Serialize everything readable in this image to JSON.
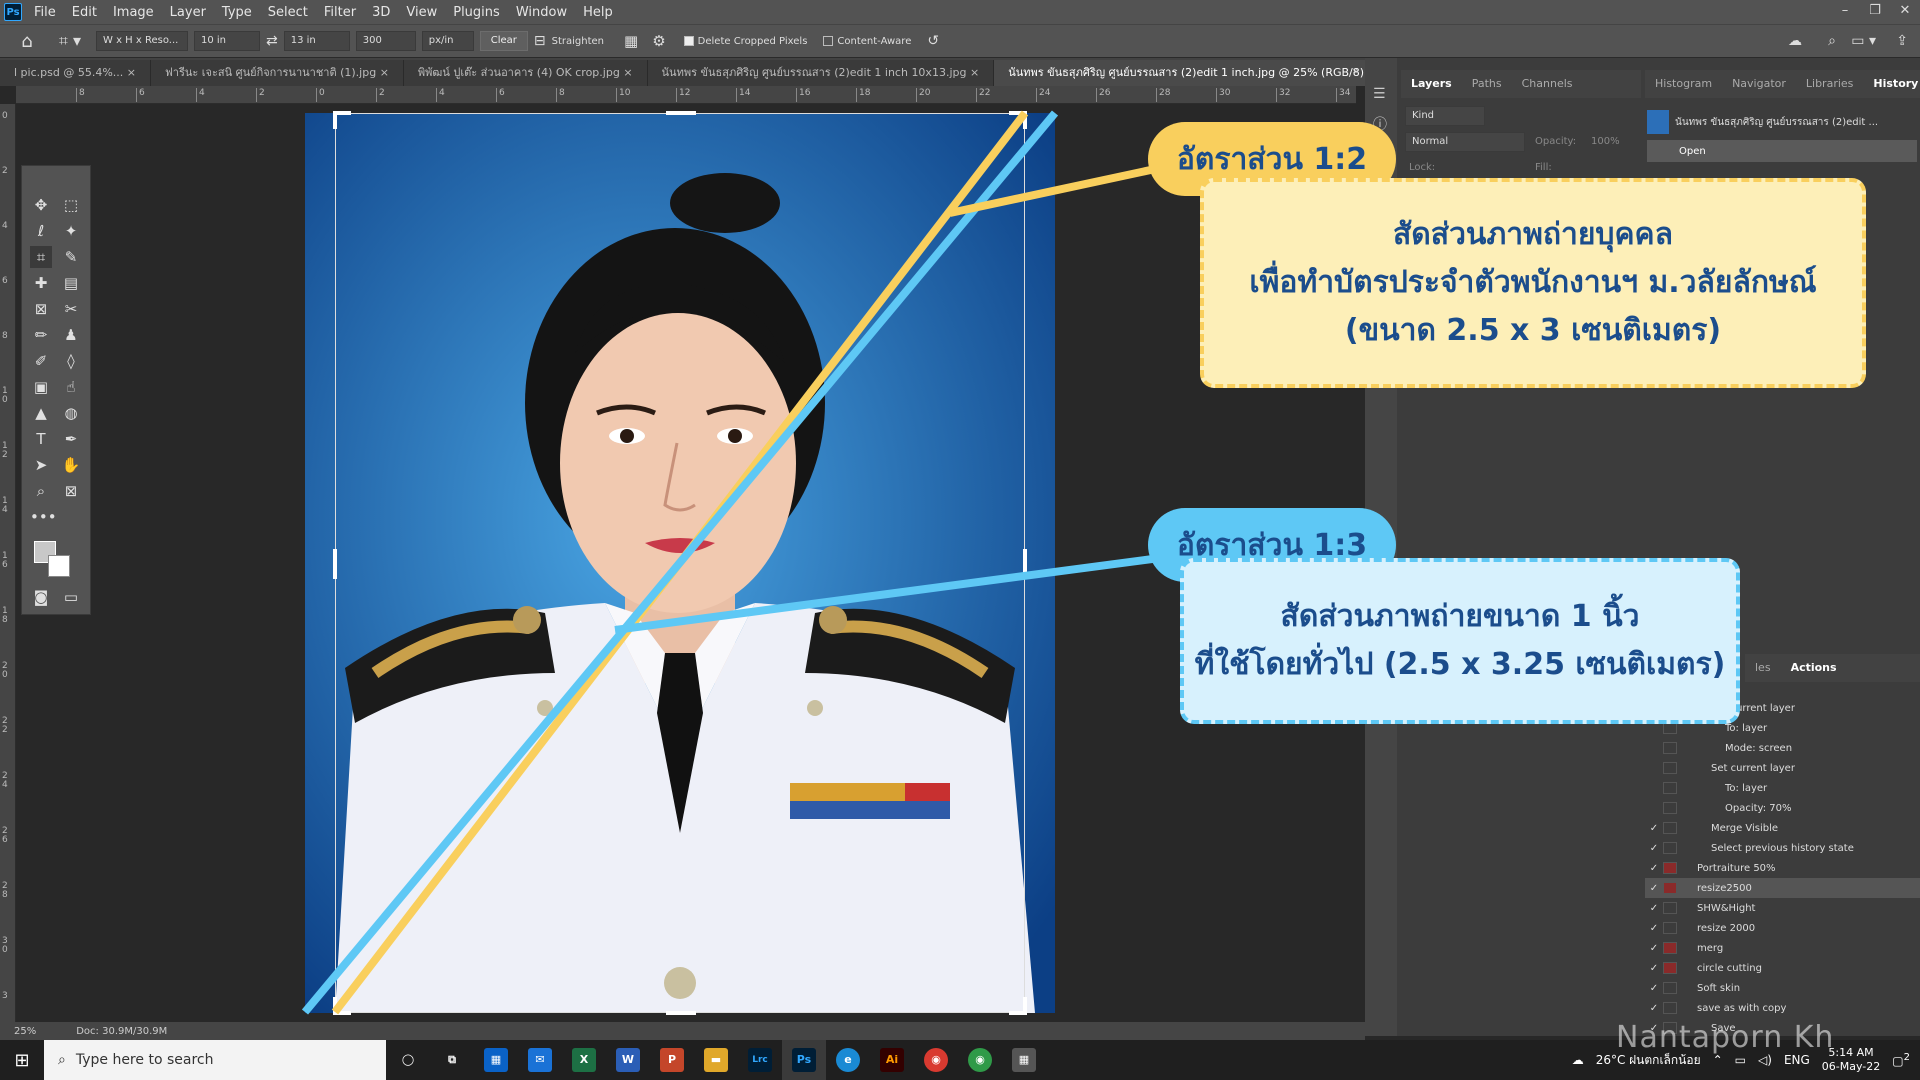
{
  "app": {
    "logo": "Ps",
    "menus": [
      "File",
      "Edit",
      "Image",
      "Layer",
      "Type",
      "Select",
      "Filter",
      "3D",
      "View",
      "Plugins",
      "Window",
      "Help"
    ]
  },
  "window_controls": {
    "minimize": "–",
    "restore": "❐",
    "close": "✕"
  },
  "options_bar": {
    "ratio_preset": "W x H x Reso...",
    "width": "10 in",
    "height": "13 in",
    "resolution": "300",
    "unit": "px/in",
    "clear": "Clear",
    "straighten": "Straighten",
    "delete_cropped": "Delete Cropped Pixels",
    "content_aware": "Content-Aware"
  },
  "tabs": [
    {
      "label": "l pic.psd @ 55.4%...",
      "close": "×"
    },
    {
      "label": "ฟารีนะ เจะสนิ ศูนย์กิจการนานาชาติ (1).jpg",
      "close": "×"
    },
    {
      "label": "พิพัฒน์ ปูเต๊ะ ส่วนอาคาร (4) OK crop.jpg",
      "close": "×"
    },
    {
      "label": "นันทพร ขันธสุภศิริญ ศูนย์บรรณสาร (2)edit 1 inch 10x13.jpg",
      "close": "×"
    },
    {
      "label": "นันทพร ขันธสุภศิริญ ศูนย์บรรณสาร (2)edit 1 inch.jpg @ 25% (RGB/8)",
      "close": "×"
    }
  ],
  "ruler_ticks": [
    "8",
    "6",
    "4",
    "2",
    "0",
    "2",
    "4",
    "6",
    "8",
    "10",
    "12",
    "14",
    "16",
    "18",
    "20",
    "22",
    "24",
    "26",
    "28",
    "30",
    "32",
    "34"
  ],
  "ruler_v_ticks": [
    "0",
    "2",
    "4",
    "6",
    "8",
    "1 0",
    "1 2",
    "1 4",
    "1 6",
    "1 8",
    "2 0",
    "2 2",
    "2 4",
    "2 6",
    "2 8",
    "3 0",
    "3"
  ],
  "status": {
    "zoom": "25%",
    "doc": "Doc: 30.9M/30.9M"
  },
  "annotations": {
    "ratio_12": {
      "label": "อัตราส่วน 1:2",
      "lines": [
        "สัดส่วนภาพถ่ายบุคคล",
        "เพื่อทำบัตรประจำตัวพนักงานฯ ม.วลัยลักษณ์",
        "(ขนาด 2.5 x 3 เซนติเมตร)"
      ]
    },
    "ratio_13": {
      "label": "อัตราส่วน 1:3",
      "lines": [
        "สัดส่วนภาพถ่ายขนาด 1 นิ้ว",
        "ที่ใช้โดยทั่วไป (2.5 x 3.25 เซนติเมตร)"
      ]
    },
    "colors": {
      "yellow": "#f9cf5d",
      "blue": "#5ec8f5",
      "yellow_fill": "#fdefb8",
      "blue_fill": "#d7f1fd",
      "text": "#1b4d8c"
    }
  },
  "layers_panel": {
    "tabs": [
      "Layers",
      "Paths",
      "Channels"
    ],
    "kind": "Kind",
    "blend": "Normal",
    "opacity_label": "Opacity:",
    "opacity": "100%",
    "lock": "Lock:",
    "fill": "Fill:"
  },
  "history_panel": {
    "tabs": [
      "Histogram",
      "Navigator",
      "Libraries",
      "History"
    ],
    "snapshot": "นันทพร ขันธสุภศิริญ ศูนย์บรรณสาร (2)edit ...",
    "items": [
      "Open"
    ]
  },
  "actions_panel": {
    "tabs": [
      "les",
      "Actions"
    ],
    "rows": [
      {
        "text": "Set current layer",
        "indent": 2,
        "check": false,
        "red": false
      },
      {
        "text": "To: layer",
        "indent": 3,
        "check": false,
        "red": false
      },
      {
        "text": "Mode: screen",
        "indent": 3,
        "check": false,
        "red": false
      },
      {
        "text": "Set current layer",
        "indent": 2,
        "check": false,
        "red": false
      },
      {
        "text": "To: layer",
        "indent": 3,
        "check": false,
        "red": false
      },
      {
        "text": "Opacity: 70%",
        "indent": 3,
        "check": false,
        "red": false
      },
      {
        "text": "Merge Visible",
        "indent": 2,
        "check": true,
        "red": false
      },
      {
        "text": "Select previous history state",
        "indent": 2,
        "check": true,
        "red": false
      },
      {
        "text": "Portraiture 50%",
        "indent": 1,
        "check": true,
        "red": true
      },
      {
        "text": "resize2500",
        "indent": 1,
        "check": true,
        "red": true
      },
      {
        "text": "SHW&Hight",
        "indent": 1,
        "check": true,
        "red": false
      },
      {
        "text": "resize 2000",
        "indent": 1,
        "check": true,
        "red": false
      },
      {
        "text": "merg",
        "indent": 1,
        "check": true,
        "red": true
      },
      {
        "text": "circle cutting",
        "indent": 1,
        "check": true,
        "red": true
      },
      {
        "text": "Soft skin",
        "indent": 1,
        "check": true,
        "red": false
      },
      {
        "text": "save as with copy",
        "indent": 1,
        "check": true,
        "red": false
      },
      {
        "text": "Save",
        "indent": 2,
        "check": true,
        "red": false
      }
    ]
  },
  "taskbar": {
    "search_placeholder": "Type here to search",
    "apps": [
      "◯",
      "⧉",
      "▦",
      "✉",
      "X",
      "W",
      "P",
      "▬",
      "Lrc",
      "Ps",
      "e",
      "Ai",
      "◉",
      "◉",
      "▦"
    ],
    "weather": "26°C ฝนตกเล็กน้อย",
    "lang": "ENG",
    "time": "5:14 AM",
    "date": "06-May-22",
    "notification_count": "2"
  },
  "watermark": "Nantaporn Kh"
}
